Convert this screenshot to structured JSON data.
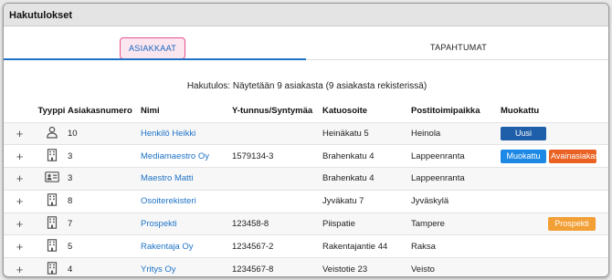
{
  "header": {
    "title": "Hakutulokset"
  },
  "tabs": [
    {
      "label": "ASIAKKAAT",
      "active": true
    },
    {
      "label": "TAPAHTUMAT",
      "active": false
    }
  ],
  "summary": "Hakutulos: Näytetään 9 asiakasta (9 asiakasta rekisterissä)",
  "columns": {
    "type": "Tyyppi",
    "number": "Asiakasnumero",
    "name": "Nimi",
    "ytunnus": "Y-tunnus/Syntymäa",
    "address": "Katuosoite",
    "city": "Postitoimipaikka",
    "muokattu": "Muokattu"
  },
  "rows": [
    {
      "expand": "+",
      "type_icon": "person-icon",
      "number": "10",
      "name": "Henkilö Heikki",
      "ytunnus": "",
      "address": "Heinäkatu 5",
      "city": "Heinola",
      "badges": [
        "Uusi"
      ]
    },
    {
      "expand": "+",
      "type_icon": "building-icon",
      "number": "3",
      "name": "Mediamaestro Oy",
      "ytunnus": "1579134-3",
      "address": "Brahenkatu 4",
      "city": "Lappeenranta",
      "badges": [
        "Muokattu",
        "Avainasiakas"
      ]
    },
    {
      "expand": "+",
      "type_icon": "contact-card-icon",
      "number": "3",
      "name": "Maestro Matti",
      "ytunnus": "",
      "address": "Brahenkatu 4",
      "city": "Lappeenranta",
      "badges": []
    },
    {
      "expand": "+",
      "type_icon": "building-icon",
      "number": "8",
      "name": "Osoiterekisteri",
      "ytunnus": "",
      "address": "Jyväkatu 7",
      "city": "Jyväskylä",
      "badges": []
    },
    {
      "expand": "+",
      "type_icon": "building-icon",
      "number": "7",
      "name": "Prospekti",
      "ytunnus": "123458-8",
      "address": "Piispatie",
      "city": "Tampere",
      "badges": [
        "Prospekti"
      ]
    },
    {
      "expand": "+",
      "type_icon": "building-icon",
      "number": "5",
      "name": "Rakentaja Oy",
      "ytunnus": "1234567-2",
      "address": "Rakentajantie 44",
      "city": "Raksa",
      "badges": []
    },
    {
      "expand": "+",
      "type_icon": "building-icon",
      "number": "4",
      "name": "Yritys Oy",
      "ytunnus": "1234567-8",
      "address": "Veistotie 23",
      "city": "Veisto",
      "badges": []
    }
  ],
  "colors": {
    "accent_blue": "#1e73c7",
    "badge_uusi": "#1f5ea8",
    "badge_muokattu": "#1e88e5",
    "badge_avainasiakas": "#e96224",
    "badge_prospekti": "#f29f35",
    "active_tab_border": "#e94f8f"
  }
}
